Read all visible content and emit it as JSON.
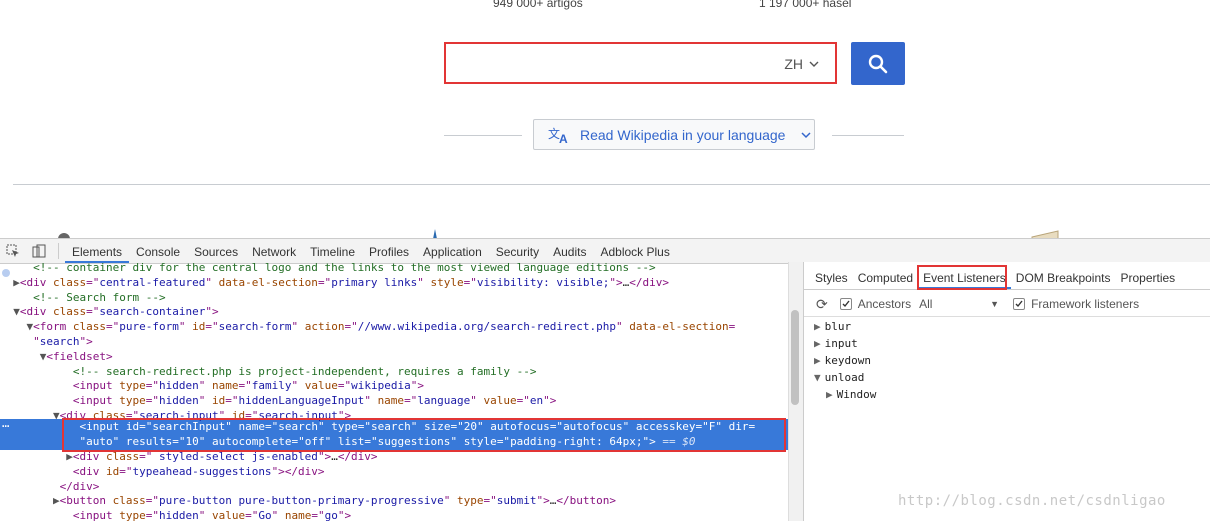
{
  "portal": {
    "stat_left": "949 000+ artigos",
    "stat_right": "1 197 000+ hasel",
    "search": {
      "value": "",
      "lang": "ZH"
    },
    "read_lang_label": "Read Wikipedia in your language",
    "accent": "#3366cc"
  },
  "devtools": {
    "tabs": [
      "Elements",
      "Console",
      "Sources",
      "Network",
      "Timeline",
      "Profiles",
      "Application",
      "Security",
      "Audits",
      "Adblock Plus"
    ],
    "active_tab": "Elements",
    "dom": [
      {
        "pre": "    ",
        "tri": "",
        "parts": [
          [
            "cm",
            "<!-- container div for the central logo and the links to the most viewed language editions -->"
          ]
        ]
      },
      {
        "pre": "  ",
        "tri": "▶",
        "parts": [
          [
            "tag",
            "<div "
          ],
          [
            "an",
            "class"
          ],
          [
            "tag",
            "=\""
          ],
          [
            "av",
            "central-featured"
          ],
          [
            "tag",
            "\" "
          ],
          [
            "an",
            "data-el-section"
          ],
          [
            "tag",
            "=\""
          ],
          [
            "av",
            "primary links"
          ],
          [
            "tag",
            "\" "
          ],
          [
            "an",
            "style"
          ],
          [
            "tag",
            "=\""
          ],
          [
            "av",
            "visibility: visible;"
          ],
          [
            "tag",
            "\">"
          ],
          [
            "tx",
            "…"
          ],
          [
            "tag",
            "</div>"
          ]
        ]
      },
      {
        "pre": "    ",
        "tri": "",
        "parts": [
          [
            "cm",
            "<!-- Search form -->"
          ]
        ]
      },
      {
        "pre": "  ",
        "tri": "▼",
        "parts": [
          [
            "tag",
            "<div "
          ],
          [
            "an",
            "class"
          ],
          [
            "tag",
            "=\""
          ],
          [
            "av",
            "search-container"
          ],
          [
            "tag",
            "\">"
          ]
        ]
      },
      {
        "pre": "    ",
        "tri": "▼",
        "parts": [
          [
            "tag",
            "<form "
          ],
          [
            "an",
            "class"
          ],
          [
            "tag",
            "=\""
          ],
          [
            "av",
            "pure-form"
          ],
          [
            "tag",
            "\" "
          ],
          [
            "an",
            "id"
          ],
          [
            "tag",
            "=\""
          ],
          [
            "av",
            "search-form"
          ],
          [
            "tag",
            "\" "
          ],
          [
            "an",
            "action"
          ],
          [
            "tag",
            "=\""
          ],
          [
            "av",
            "//www.wikipedia.org/search-redirect.php"
          ],
          [
            "tag",
            "\" "
          ],
          [
            "an",
            "data-el-section"
          ],
          [
            "tag",
            "="
          ]
        ]
      },
      {
        "pre": "    ",
        "tri": "",
        "parts": [
          [
            "tag",
            "\""
          ],
          [
            "av",
            "search"
          ],
          [
            "tag",
            "\">"
          ]
        ]
      },
      {
        "pre": "      ",
        "tri": "▼",
        "parts": [
          [
            "tag",
            "<fieldset>"
          ]
        ]
      },
      {
        "pre": "          ",
        "tri": "",
        "parts": [
          [
            "cm",
            "<!-- search-redirect.php is project-independent, requires a family -->"
          ]
        ]
      },
      {
        "pre": "          ",
        "tri": "",
        "parts": [
          [
            "tag",
            "<input "
          ],
          [
            "an",
            "type"
          ],
          [
            "tag",
            "=\""
          ],
          [
            "av",
            "hidden"
          ],
          [
            "tag",
            "\" "
          ],
          [
            "an",
            "name"
          ],
          [
            "tag",
            "=\""
          ],
          [
            "av",
            "family"
          ],
          [
            "tag",
            "\" "
          ],
          [
            "an",
            "value"
          ],
          [
            "tag",
            "=\""
          ],
          [
            "av",
            "wikipedia"
          ],
          [
            "tag",
            "\">"
          ]
        ]
      },
      {
        "pre": "          ",
        "tri": "",
        "parts": [
          [
            "tag",
            "<input "
          ],
          [
            "an",
            "type"
          ],
          [
            "tag",
            "=\""
          ],
          [
            "av",
            "hidden"
          ],
          [
            "tag",
            "\" "
          ],
          [
            "an",
            "id"
          ],
          [
            "tag",
            "=\""
          ],
          [
            "av",
            "hiddenLanguageInput"
          ],
          [
            "tag",
            "\" "
          ],
          [
            "an",
            "name"
          ],
          [
            "tag",
            "=\""
          ],
          [
            "av",
            "language"
          ],
          [
            "tag",
            "\" "
          ],
          [
            "an",
            "value"
          ],
          [
            "tag",
            "=\""
          ],
          [
            "av",
            "en"
          ],
          [
            "tag",
            "\">"
          ]
        ]
      },
      {
        "pre": "        ",
        "tri": "▼",
        "parts": [
          [
            "tag",
            "<div "
          ],
          [
            "an",
            "class"
          ],
          [
            "tag",
            "=\""
          ],
          [
            "av",
            "search-input"
          ],
          [
            "tag",
            "\" "
          ],
          [
            "an",
            "id"
          ],
          [
            "tag",
            "=\""
          ],
          [
            "av",
            "search-input"
          ],
          [
            "tag",
            "\">"
          ]
        ]
      }
    ],
    "selected": [
      {
        "pre": "            ",
        "parts": [
          [
            "tag",
            "<input "
          ],
          [
            "an",
            "id"
          ],
          [
            "tag",
            "=\""
          ],
          [
            "av",
            "searchInput"
          ],
          [
            "tag",
            "\" "
          ],
          [
            "an",
            "name"
          ],
          [
            "tag",
            "=\""
          ],
          [
            "av",
            "search"
          ],
          [
            "tag",
            "\" "
          ],
          [
            "an",
            "type"
          ],
          [
            "tag",
            "=\""
          ],
          [
            "av",
            "search"
          ],
          [
            "tag",
            "\" "
          ],
          [
            "an",
            "size"
          ],
          [
            "tag",
            "=\""
          ],
          [
            "av",
            "20"
          ],
          [
            "tag",
            "\" "
          ],
          [
            "an",
            "autofocus"
          ],
          [
            "tag",
            "=\""
          ],
          [
            "av",
            "autofocus"
          ],
          [
            "tag",
            "\" "
          ],
          [
            "an",
            "accesskey"
          ],
          [
            "tag",
            "=\""
          ],
          [
            "av",
            "F"
          ],
          [
            "tag",
            "\" "
          ],
          [
            "an",
            "dir"
          ],
          [
            "tag",
            "="
          ]
        ]
      },
      {
        "pre": "            ",
        "parts": [
          [
            "tag",
            "\""
          ],
          [
            "av",
            "auto"
          ],
          [
            "tag",
            "\" "
          ],
          [
            "an",
            "results"
          ],
          [
            "tag",
            "=\""
          ],
          [
            "av",
            "10"
          ],
          [
            "tag",
            "\" "
          ],
          [
            "an",
            "autocomplete"
          ],
          [
            "tag",
            "=\""
          ],
          [
            "av",
            "off"
          ],
          [
            "tag",
            "\" "
          ],
          [
            "an",
            "list"
          ],
          [
            "tag",
            "=\""
          ],
          [
            "av",
            "suggestions"
          ],
          [
            "tag",
            "\" "
          ],
          [
            "an",
            "style"
          ],
          [
            "tag",
            "=\""
          ],
          [
            "av",
            "padding-right: 64px;"
          ],
          [
            "tag",
            "\">"
          ],
          [
            "eqs",
            " == $0"
          ]
        ]
      }
    ],
    "dom_after": [
      {
        "pre": "          ",
        "tri": "▶",
        "parts": [
          [
            "tag",
            "<div "
          ],
          [
            "an",
            "class"
          ],
          [
            "tag",
            "=\""
          ],
          [
            "av",
            " styled-select js-enabled"
          ],
          [
            "tag",
            "\">"
          ],
          [
            "tx",
            "…"
          ],
          [
            "tag",
            "</div>"
          ]
        ]
      },
      {
        "pre": "          ",
        "tri": "",
        "parts": [
          [
            "tag",
            "<div "
          ],
          [
            "an",
            "id"
          ],
          [
            "tag",
            "=\""
          ],
          [
            "av",
            "typeahead-suggestions"
          ],
          [
            "tag",
            "\">"
          ],
          [
            "tag",
            "</div>"
          ]
        ]
      },
      {
        "pre": "        ",
        "tri": "",
        "parts": [
          [
            "tag",
            "</div>"
          ]
        ]
      },
      {
        "pre": "        ",
        "tri": "▶",
        "parts": [
          [
            "tag",
            "<button "
          ],
          [
            "an",
            "class"
          ],
          [
            "tag",
            "=\""
          ],
          [
            "av",
            "pure-button pure-button-primary-progressive"
          ],
          [
            "tag",
            "\" "
          ],
          [
            "an",
            "type"
          ],
          [
            "tag",
            "=\""
          ],
          [
            "av",
            "submit"
          ],
          [
            "tag",
            "\">"
          ],
          [
            "tx",
            "…"
          ],
          [
            "tag",
            "</button>"
          ]
        ]
      },
      {
        "pre": "          ",
        "tri": "",
        "parts": [
          [
            "tag",
            "<input "
          ],
          [
            "an",
            "type"
          ],
          [
            "tag",
            "=\""
          ],
          [
            "av",
            "hidden"
          ],
          [
            "tag",
            "\" "
          ],
          [
            "an",
            "value"
          ],
          [
            "tag",
            "=\""
          ],
          [
            "av",
            "Go"
          ],
          [
            "tag",
            "\" "
          ],
          [
            "an",
            "name"
          ],
          [
            "tag",
            "=\""
          ],
          [
            "av",
            "go"
          ],
          [
            "tag",
            "\">"
          ]
        ]
      }
    ],
    "sidebar": {
      "tabs": [
        "Styles",
        "Computed",
        "Event Listeners",
        "DOM Breakpoints",
        "Properties"
      ],
      "active_tab": "Event Listeners",
      "ancestors_label": "Ancestors",
      "filter_value": "All",
      "framework_label": "Framework listeners",
      "events": [
        {
          "name": "blur",
          "expanded": false,
          "indent": 0
        },
        {
          "name": "input",
          "expanded": false,
          "indent": 0
        },
        {
          "name": "keydown",
          "expanded": false,
          "indent": 0
        },
        {
          "name": "unload",
          "expanded": true,
          "indent": 0
        },
        {
          "name": "Window",
          "expanded": false,
          "indent": 1
        }
      ]
    }
  },
  "watermark": "http://blog.csdn.net/csdnligao"
}
